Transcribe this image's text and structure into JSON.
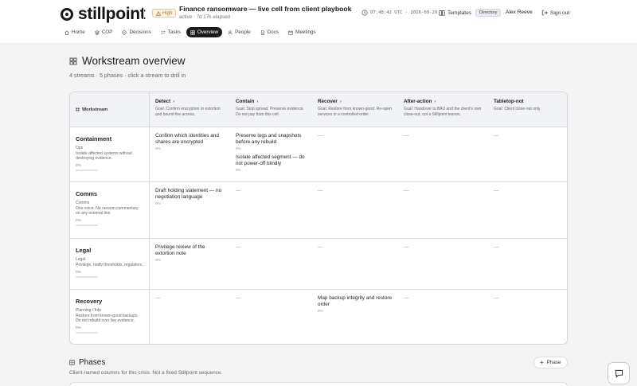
{
  "app": {
    "name": "stillpoint"
  },
  "incident": {
    "severity": "High",
    "title": "Finance ransomware — live cell from client playbook",
    "status": "active · 7d 17h elapsed",
    "clock": "07:48:42 UTC · 2026-09-29"
  },
  "header": {
    "templates_label": "Templates",
    "directory_label": "Directory",
    "user_name": "Alex Reeve",
    "signout_label": "Sign out"
  },
  "nav": [
    {
      "label": "Home",
      "icon": "home-icon"
    },
    {
      "label": "COP",
      "icon": "layers-icon"
    },
    {
      "label": "Decisions",
      "icon": "decision-icon"
    },
    {
      "label": "Tasks",
      "icon": "tasks-icon"
    },
    {
      "label": "Overview",
      "icon": "grid-icon",
      "active": true
    },
    {
      "label": "People",
      "icon": "person-icon"
    },
    {
      "label": "Docs",
      "icon": "doc-icon"
    },
    {
      "label": "Meetings",
      "icon": "calendar-icon"
    }
  ],
  "overview": {
    "title": "Workstream overview",
    "subtitle": "4 streams · 5 phases · click a stream to drill in",
    "stream_header": "Workstream",
    "phases": [
      {
        "name": "Detect",
        "goal": "Goal: Confirm encryption or extortion and bound the access."
      },
      {
        "name": "Contain",
        "goal": "Goal: Stop spread. Preserve evidence. Do not pay from this cell."
      },
      {
        "name": "Recover",
        "goal": "Goal: Restore from known-good. Re-open services in a controlled order."
      },
      {
        "name": "After-action",
        "goal": "Goal: Handover to BAU and the client's own close-out, not a Stillpoint lesson."
      },
      {
        "name": "Tabletop-not",
        "goal": "Goal: Client close-out only."
      }
    ],
    "streams": [
      {
        "name": "Containment",
        "owner": "Ops",
        "desc": "Isolate affected systems without destroying evidence.",
        "progress": "0%",
        "cells": [
          [
            {
              "title": "Confirm which identities and shares are encrypted",
              "meta": "0%"
            }
          ],
          [
            {
              "title": "Preserve logs and snapshots before any rebuild",
              "meta": "0%"
            },
            {
              "title": "Isolate affected segment — do not power-off blindly",
              "meta": "0%"
            }
          ],
          [],
          [],
          []
        ]
      },
      {
        "name": "Comms",
        "owner": "Comms",
        "desc": "One voice. No ransom commentary on any external line.",
        "progress": "0%",
        "cells": [
          [
            {
              "title": "Draft holding statement — no negotiation language",
              "meta": "0%"
            }
          ],
          [],
          [],
          [],
          []
        ]
      },
      {
        "name": "Legal",
        "owner": "Legal",
        "desc": "Privilege, notify thresholds, regulators.",
        "progress": "0%",
        "cells": [
          [
            {
              "title": "Privilege review of the extortion note",
              "meta": "0%"
            }
          ],
          [],
          [],
          [],
          []
        ]
      },
      {
        "name": "Recovery",
        "owner": "Planning / Info",
        "desc": "Restore from known-good backups. Do not rebuild over live evidence.",
        "progress": "0%",
        "cells": [
          [],
          [],
          [
            {
              "title": "Map backup integrity and restore order",
              "meta": "0%"
            }
          ],
          [],
          []
        ]
      }
    ],
    "empty_marker": "—"
  },
  "phases_section": {
    "title": "Phases",
    "subtitle": "Client-named columns for this crisis. Not a fixed Stillpoint sequence.",
    "add_label": "Phase"
  }
}
